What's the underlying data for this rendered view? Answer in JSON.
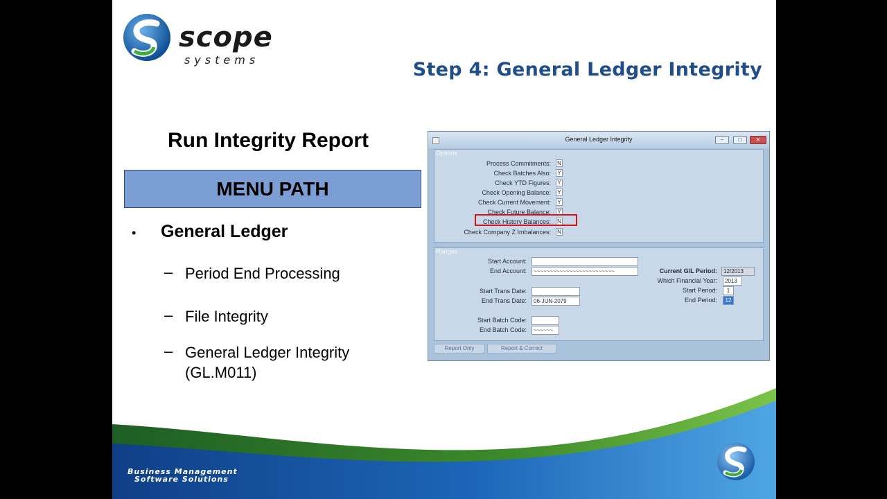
{
  "logo": {
    "word": "scope",
    "sub": "systems"
  },
  "header": {
    "step_title": "Step 4: General Ledger Integrity"
  },
  "content": {
    "title": "Run Integrity Report",
    "menu_path": "MENU PATH",
    "bullet": "•",
    "main_item": "General Ledger",
    "dash": "–",
    "sub_items": [
      "Period End Processing",
      "File Integrity",
      "General Ledger Integrity",
      "(GL.M011)"
    ]
  },
  "window": {
    "title": "General Ledger Integrity",
    "options_title": "Options",
    "options": [
      {
        "label": "Process Commitments:",
        "value": "N"
      },
      {
        "label": "Check Batches Also:",
        "value": "Y"
      },
      {
        "label": "Check YTD Figures:",
        "value": "Y"
      },
      {
        "label": "Check Opening Balance:",
        "value": "Y"
      },
      {
        "label": "Check Current Movement:",
        "value": "Y"
      },
      {
        "label": "Check Future Balance:",
        "value": "Y"
      },
      {
        "label": "Check History Balances:",
        "value": "N"
      },
      {
        "label": "Check Company Z Imbalances:",
        "value": "N"
      }
    ],
    "ranges_title": "Ranges",
    "ranges": {
      "start_account_label": "Start Account:",
      "start_account_value": "",
      "end_account_label": "End Account:",
      "end_account_value": "~~~~~~~~~~~~~~~~~~~~~~~~~",
      "start_trans_label": "Start Trans Date:",
      "start_trans_value": "",
      "end_trans_label": "End Trans Date:",
      "end_trans_value": "06-JUN-2079",
      "start_batch_label": "Start Batch Code:",
      "start_batch_value": "",
      "end_batch_label": "End Batch Code:",
      "end_batch_value": "~~~~~~",
      "current_period_label": "Current G/L Period:",
      "current_period_value": "12/2013",
      "fin_year_label": "Which Financial Year:",
      "fin_year_value": "2013",
      "start_period_label": "Start Period:",
      "start_period_value": "1",
      "end_period_label": "End Period:",
      "end_period_value": "12"
    },
    "buttons": {
      "report_only": "Report Only",
      "report_correct": "Report & Correct"
    }
  },
  "footer": {
    "tagline_line1": "Business Management",
    "tagline_line2": "Software Solutions"
  },
  "colors": {
    "accent_blue": "#1f4e8a",
    "menu_path_bg": "#7b9fd4",
    "highlight_red": "#d2121a",
    "swoosh_green": "#3c8a2a"
  }
}
